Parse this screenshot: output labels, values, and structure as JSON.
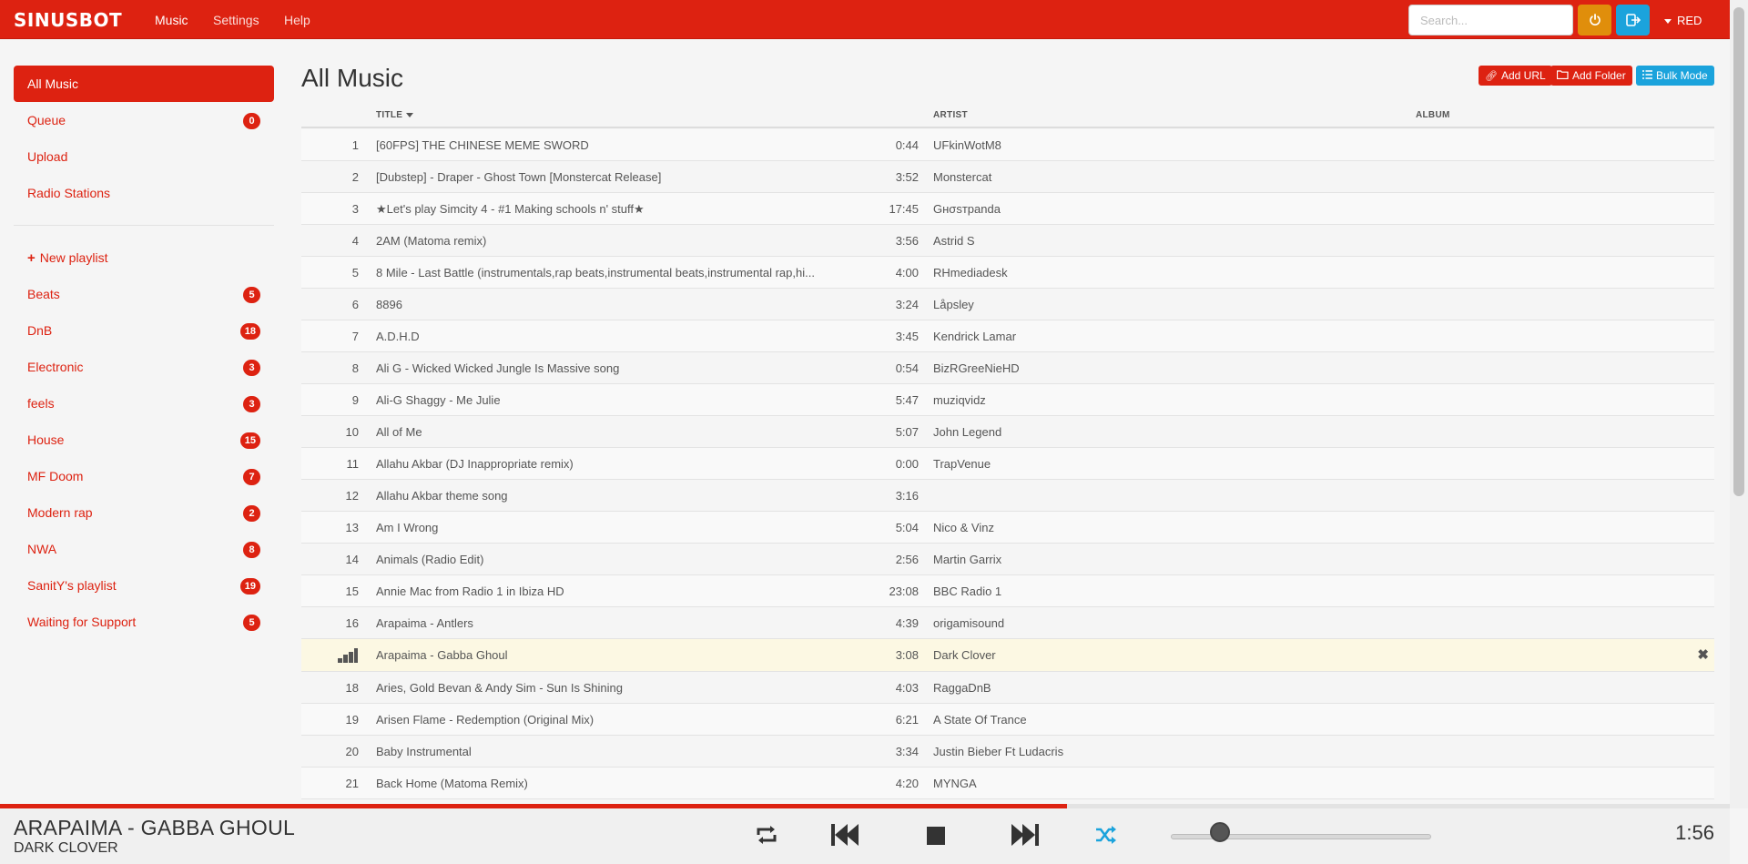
{
  "app": {
    "logo": "SINUSBOT",
    "nav": [
      "Music",
      "Settings",
      "Help"
    ],
    "search_placeholder": "Search...",
    "user_label": "RED",
    "accent": "#dd2211",
    "power_color": "#e08e0b",
    "logout_color": "#1ba3dc"
  },
  "sidebar": {
    "main": [
      {
        "label": "All Music",
        "active": true
      },
      {
        "label": "Queue",
        "badge": "0"
      },
      {
        "label": "Upload"
      },
      {
        "label": "Radio Stations"
      }
    ],
    "new_playlist": "New playlist",
    "playlists": [
      {
        "label": "Beats",
        "badge": "5"
      },
      {
        "label": "DnB",
        "badge": "18"
      },
      {
        "label": "Electronic",
        "badge": "3"
      },
      {
        "label": "feels",
        "badge": "3"
      },
      {
        "label": "House",
        "badge": "15"
      },
      {
        "label": "MF Doom",
        "badge": "7"
      },
      {
        "label": "Modern rap",
        "badge": "2"
      },
      {
        "label": "NWA",
        "badge": "8"
      },
      {
        "label": "SanitY's playlist",
        "badge": "19"
      },
      {
        "label": "Waiting for Support",
        "badge": "5"
      }
    ]
  },
  "main": {
    "title": "All Music",
    "buttons": {
      "add_url": "Add URL",
      "add_folder": "Add Folder",
      "bulk_mode": "Bulk Mode"
    },
    "columns": {
      "title": "TITLE",
      "artist": "ARTIST",
      "album": "ALBUM"
    },
    "tracks": [
      {
        "num": "1",
        "title": "[60FPS] THE CHINESE MEME SWORD",
        "duration": "0:44",
        "artist": "UFkinWotM8"
      },
      {
        "num": "2",
        "title": "[Dubstep] - Draper - Ghost Town [Monstercat Release]",
        "duration": "3:52",
        "artist": "Monstercat"
      },
      {
        "num": "3",
        "title": "★Let's play Simcity 4 - #1 Making schools n' stuff★",
        "duration": "17:45",
        "artist": "Gнσѕтpanda"
      },
      {
        "num": "4",
        "title": "2AM (Matoma remix)",
        "duration": "3:56",
        "artist": "Astrid S"
      },
      {
        "num": "5",
        "title": "8 Mile - Last Battle (instrumentals,rap beats,instrumental beats,instrumental rap,hi...",
        "duration": "4:00",
        "artist": "RHmediadesk"
      },
      {
        "num": "6",
        "title": "8896",
        "duration": "3:24",
        "artist": "Låpsley"
      },
      {
        "num": "7",
        "title": "A.D.H.D",
        "duration": "3:45",
        "artist": "Kendrick Lamar"
      },
      {
        "num": "8",
        "title": "Ali G - Wicked Wicked Jungle Is Massive song",
        "duration": "0:54",
        "artist": "BizRGreeNieHD"
      },
      {
        "num": "9",
        "title": "Ali-G Shaggy - Me Julie",
        "duration": "5:47",
        "artist": "muziqvidz"
      },
      {
        "num": "10",
        "title": "All of Me",
        "duration": "5:07",
        "artist": "John Legend"
      },
      {
        "num": "11",
        "title": "Allahu Akbar (DJ Inappropriate remix)",
        "duration": "0:00",
        "artist": "TrapVenue"
      },
      {
        "num": "12",
        "title": "Allahu Akbar theme song",
        "duration": "3:16",
        "artist": ""
      },
      {
        "num": "13",
        "title": "Am I Wrong",
        "duration": "5:04",
        "artist": "Nico & Vinz"
      },
      {
        "num": "14",
        "title": "Animals (Radio Edit)",
        "duration": "2:56",
        "artist": "Martin Garrix"
      },
      {
        "num": "15",
        "title": "Annie Mac from Radio 1 in Ibiza HD",
        "duration": "23:08",
        "artist": "BBC Radio 1"
      },
      {
        "num": "16",
        "title": "Arapaima - Antlers",
        "duration": "4:39",
        "artist": "origamisound"
      },
      {
        "num": "",
        "title": "Arapaima - Gabba Ghoul",
        "duration": "3:08",
        "artist": "Dark Clover",
        "playing": true
      },
      {
        "num": "18",
        "title": "Aries, Gold Bevan & Andy Sim - Sun Is Shining",
        "duration": "4:03",
        "artist": "RaggaDnB"
      },
      {
        "num": "19",
        "title": "Arisen Flame - Redemption (Original Mix)",
        "duration": "6:21",
        "artist": "A State Of Trance"
      },
      {
        "num": "20",
        "title": "Baby Instrumental",
        "duration": "3:34",
        "artist": "Justin Bieber Ft Ludacris"
      },
      {
        "num": "21",
        "title": "Back Home (Matoma Remix)",
        "duration": "4:20",
        "artist": "MYNGA"
      }
    ]
  },
  "player": {
    "title": "Arapaima - Gabba Ghoul",
    "artist": "Dark Clover",
    "time": "1:56",
    "progress_fraction": 0.617,
    "volume_fraction": 0.19,
    "icons": [
      "repeat-icon",
      "previous-icon",
      "stop-icon",
      "next-icon",
      "shuffle-icon"
    ],
    "shuffle_active_color": "#1ba3dc"
  }
}
